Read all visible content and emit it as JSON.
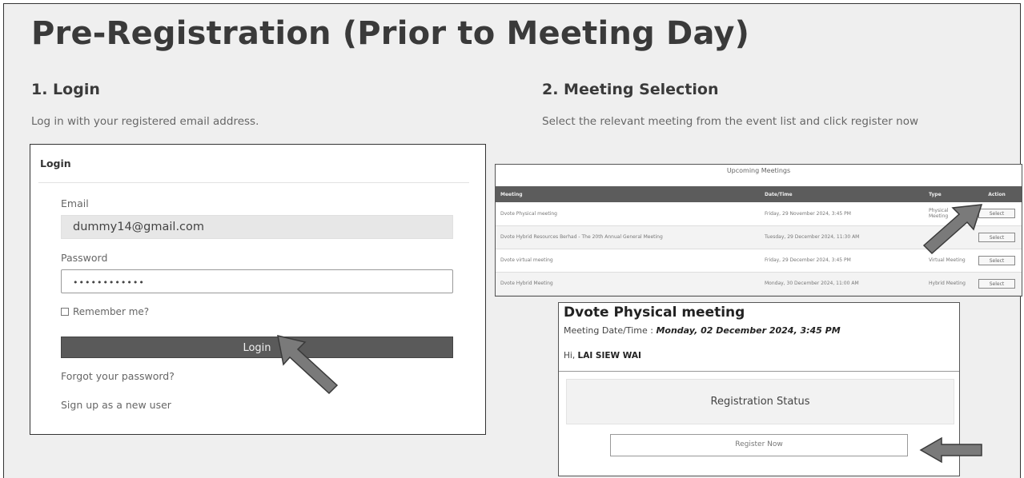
{
  "page": {
    "title": "Pre-Registration (Prior to Meeting Day)"
  },
  "step1": {
    "title": "1. Login",
    "description": "Log in with your registered email address."
  },
  "step2": {
    "title": "2. Meeting Selection",
    "description": "Select the relevant meeting from the event list and click register now"
  },
  "login_form": {
    "heading": "Login",
    "email_label": "Email",
    "email_value": "dummy14@gmail.com",
    "password_label": "Password",
    "password_value": "••••••••••••",
    "remember_label": "Remember me?",
    "remember_checked": false,
    "submit_label": "Login",
    "forgot_link": "Forgot your password?",
    "signup_link": "Sign up as a new user"
  },
  "meetings": {
    "title": "Upcoming Meetings",
    "columns": [
      "Meeting",
      "Date/Time",
      "Type",
      "Action"
    ],
    "rows": [
      {
        "meeting": "Dvote Physical meeting",
        "datetime": "Friday, 29 November 2024, 3:45 PM",
        "type": "Physical Meeting",
        "action": "Select"
      },
      {
        "meeting": "Dvote Hybrid Resources Berhad - The 20th Annual General Meeting",
        "datetime": "Tuesday, 29 December 2024, 11:30 AM",
        "type": "",
        "action": "Select"
      },
      {
        "meeting": "Dvote virtual meeting",
        "datetime": "Friday, 29 December 2024, 3:45 PM",
        "type": "Virtual Meeting",
        "action": "Select"
      },
      {
        "meeting": "Dvote Hybrid Meeting",
        "datetime": "Monday, 30 December 2024, 11:00 AM",
        "type": "Hybrid Meeting",
        "action": "Select"
      }
    ]
  },
  "meeting_detail": {
    "title": "Dvote Physical meeting",
    "date_label": "Meeting Date/Time :",
    "date_value": "Monday, 02 December 2024, 3:45 PM",
    "greeting_prefix": "Hi,",
    "user_name": "LAI SIEW WAI",
    "status_label": "Registration Status",
    "register_label": "Register Now"
  },
  "colors": {
    "page_background": "#efefef",
    "primary_button": "#5a5a5a",
    "table_header": "#5c5c5c",
    "arrow_fill": "#7a7a7a"
  }
}
